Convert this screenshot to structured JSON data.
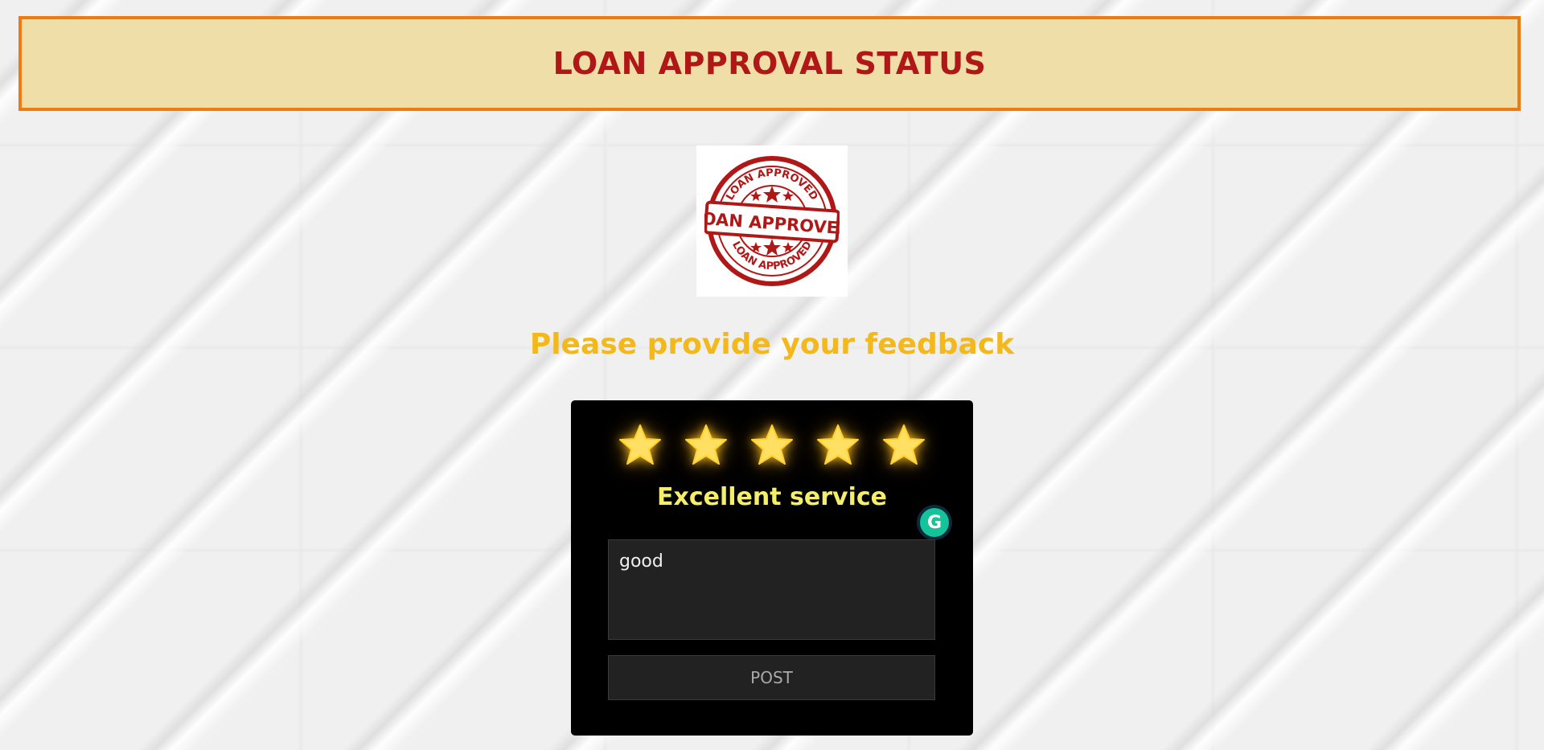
{
  "header": {
    "title": "LOAN APPROVAL STATUS",
    "border_color": "#f07a12",
    "background_color": "#f0dea8",
    "title_color": "#b01818"
  },
  "status_image": {
    "icon": "loan-approved-stamp",
    "stamp_text": "LOAN APPROVED",
    "stamp_color": "#b01818"
  },
  "feedback": {
    "title": "Please provide your feedback",
    "title_color": "#f2b81c",
    "rating": {
      "value": 5,
      "max": 5,
      "label": "Excellent service",
      "star_color": "#ffe063",
      "label_color": "#f4ee6a"
    },
    "comment_value": "good",
    "post_label": "POST"
  },
  "extensions": {
    "grammarly_icon": "grammarly-icon",
    "grammarly_glyph": "G"
  }
}
